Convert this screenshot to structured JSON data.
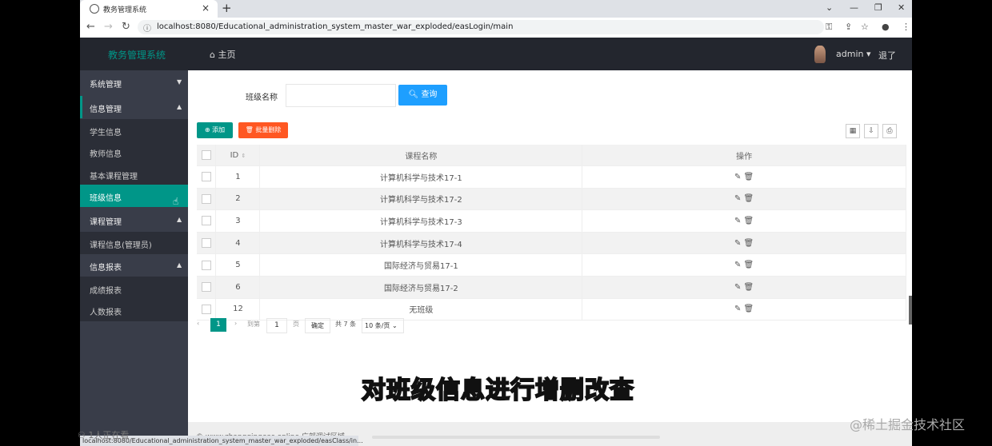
{
  "browser": {
    "tab_title": "教务管理系统",
    "url": "localhost:8080/Educational_administration_system_master_war_exploded/easLogin/main",
    "status_url": "localhost:8080/Educational_administration_system_master_war_exploded/easClass/in..."
  },
  "header": {
    "brand": "教务管理系统",
    "home": "主页",
    "user": "admin",
    "logout": "退了"
  },
  "sidebar": [
    {
      "label": "系统管理",
      "type": "group"
    },
    {
      "label": "信息管理",
      "type": "group"
    },
    {
      "label": "学生信息",
      "type": "sub"
    },
    {
      "label": "教师信息",
      "type": "sub"
    },
    {
      "label": "基本课程管理",
      "type": "sub"
    },
    {
      "label": "班级信息",
      "type": "active"
    },
    {
      "label": "课程管理",
      "type": "group"
    },
    {
      "label": "课程信息(管理员)",
      "type": "sub"
    },
    {
      "label": "信息报表",
      "type": "group"
    },
    {
      "label": "成绩报表",
      "type": "sub"
    },
    {
      "label": "人数报表",
      "type": "sub"
    }
  ],
  "search": {
    "label": "班级名称",
    "placeholder": "",
    "button": "查询"
  },
  "toolbar": {
    "add": "添加",
    "batch_delete": "批量删除"
  },
  "table": {
    "headers": [
      "ID",
      "课程名称",
      "操作"
    ],
    "rows": [
      {
        "id": "1",
        "name": "计算机科学与技术17-1"
      },
      {
        "id": "2",
        "name": "计算机科学与技术17-2"
      },
      {
        "id": "3",
        "name": "计算机科学与技术17-3"
      },
      {
        "id": "4",
        "name": "计算机科学与技术17-4"
      },
      {
        "id": "5",
        "name": "国际经济与贸易17-1"
      },
      {
        "id": "6",
        "name": "国际经济与贸易17-2"
      },
      {
        "id": "12",
        "name": "无班级"
      }
    ]
  },
  "pager": {
    "current": "1",
    "goto_label": "到第",
    "page_input": "1",
    "page_unit": "页",
    "confirm": "确定",
    "total": "共 7 条",
    "page_size": "10 条/页"
  },
  "footer": {
    "text": "© www.zhangqingeas.online 广部调试区域"
  },
  "overlay": {
    "caption": "对班级信息进行增删改查",
    "watching": "1人正在看",
    "watermark": "@稀土掘金技术社区"
  },
  "colors": {
    "accent": "#009688",
    "primary": "#1e9fff",
    "danger": "#ff5722",
    "header_bg": "#23262e",
    "sidebar_bg": "#393d49"
  }
}
